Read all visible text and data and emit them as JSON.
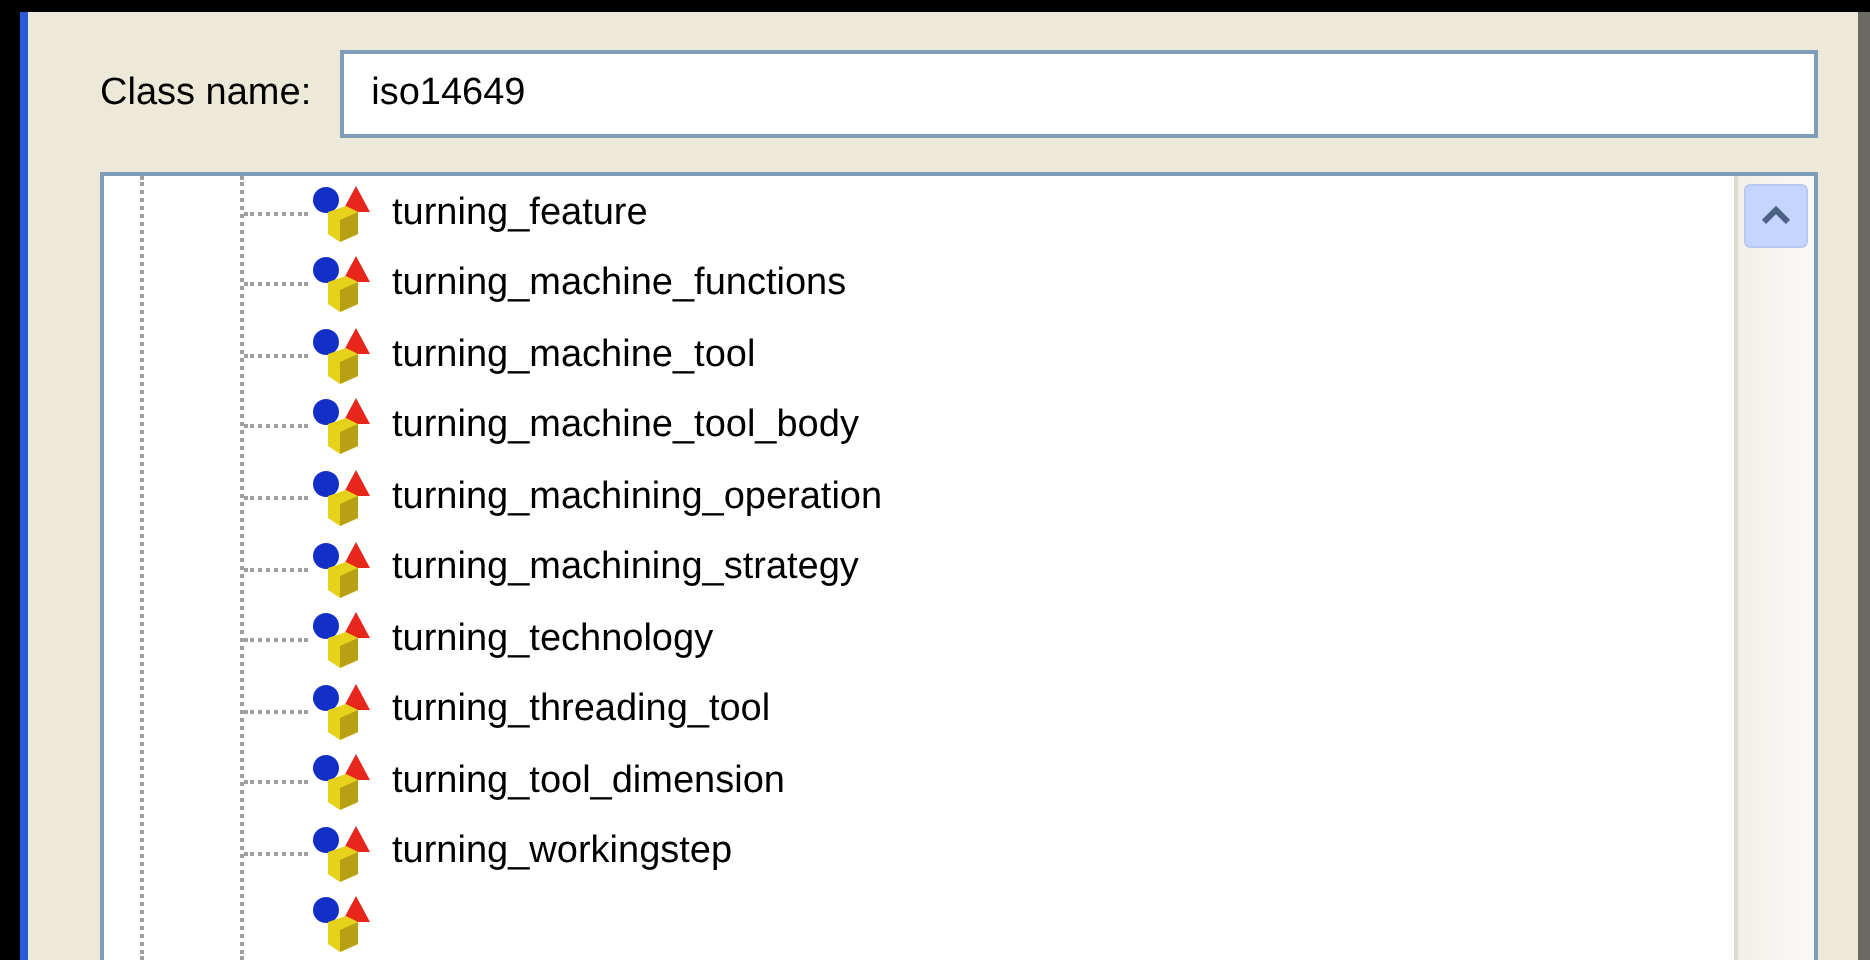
{
  "class_name": {
    "label": "Class name:",
    "value": "iso14649"
  },
  "tree": {
    "items": [
      {
        "label": "turning_feature"
      },
      {
        "label": "turning_machine_functions"
      },
      {
        "label": "turning_machine_tool"
      },
      {
        "label": "turning_machine_tool_body"
      },
      {
        "label": "turning_machining_operation"
      },
      {
        "label": "turning_machining_strategy"
      },
      {
        "label": "turning_technology"
      },
      {
        "label": "turning_threading_tool"
      },
      {
        "label": "turning_tool_dimension"
      },
      {
        "label": "turning_workingstep"
      }
    ]
  }
}
